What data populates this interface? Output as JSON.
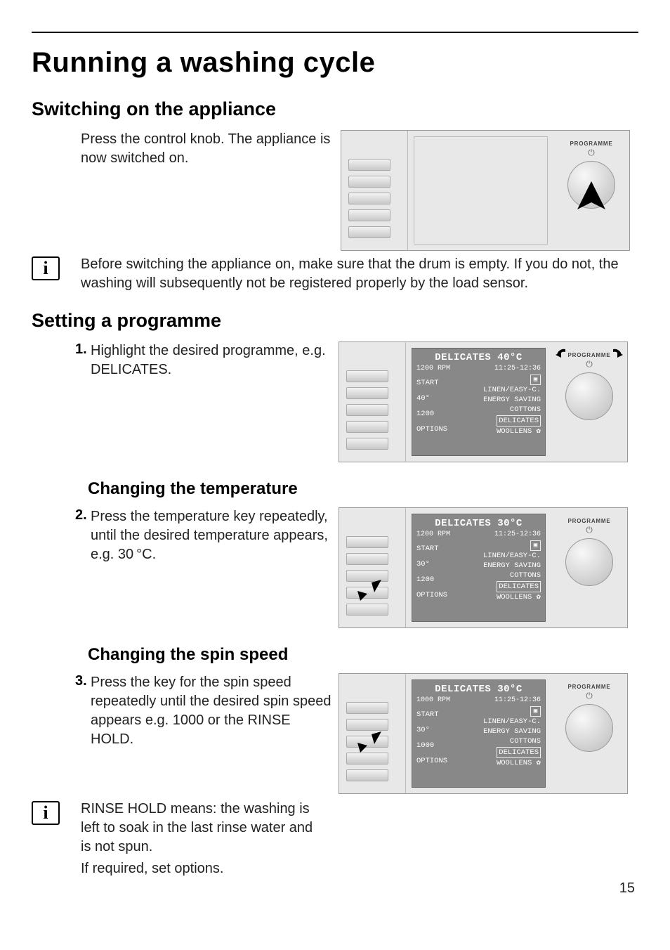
{
  "page_number": "15",
  "title": "Running a washing cycle",
  "section_switching": {
    "heading": "Switching on the appliance",
    "para1": "Press the control knob. The appliance is now switched on.",
    "para2": "Before switching the appliance on, make sure that the drum is empty. If you do not, the washing will subsequently not be registered properly by the load sensor."
  },
  "section_programme": {
    "heading": "Setting a programme",
    "step_num": "1.",
    "step_text": "Highlight the desired programme, e.g. DELICATES.",
    "screen": {
      "title": "DELICATES 40°C",
      "rpm": "1200 RPM",
      "time": "11:25-12:36",
      "left": [
        "START",
        "40°",
        "1200",
        "OPTIONS"
      ],
      "right": [
        "LINEN/EASY-C.",
        "ENERGY SAVING",
        "COTTONS",
        "DELICATES",
        "WOOLLENS"
      ],
      "highlighted": "DELICATES"
    }
  },
  "section_temp": {
    "heading": "Changing the temperature",
    "step_num": "2.",
    "step_text": "Press the temperature key repeatedly, until the desired temperature appears, e.g. 30 °C.",
    "screen": {
      "title": "DELICATES 30°C",
      "rpm": "1200 RPM",
      "time": "11:25-12:36",
      "left": [
        "START",
        "30°",
        "1200",
        "OPTIONS"
      ],
      "right": [
        "LINEN/EASY-C.",
        "ENERGY SAVING",
        "COTTONS",
        "DELICATES",
        "WOOLLENS"
      ],
      "highlighted": "DELICATES"
    }
  },
  "section_spin": {
    "heading": "Changing the spin speed",
    "step_num": "3.",
    "step_text": "Press the key for the spin speed repeatedly until the desired spin speed appears e.g. 1000 or the RINSE HOLD.",
    "info": "RINSE HOLD means: the washing is left to soak in the last rinse water and is not spun.",
    "extra": "If required, set options.",
    "screen": {
      "title": "DELICATES 30°C",
      "rpm": "1000 RPM",
      "time": "11:25-12:36",
      "left": [
        "START",
        "30°",
        "1000",
        "OPTIONS"
      ],
      "right": [
        "LINEN/EASY-C.",
        "ENERGY SAVING",
        "COTTONS",
        "DELICATES",
        "WOOLLENS"
      ],
      "highlighted": "DELICATES"
    }
  },
  "labels": {
    "programme": "PROGRAMME"
  }
}
